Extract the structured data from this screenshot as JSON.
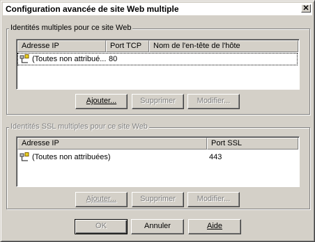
{
  "dialog": {
    "title": "Configuration avancée de site Web multiple",
    "close_glyph": "✕"
  },
  "identities": {
    "legend": "Identités multiples pour ce site Web",
    "columns": [
      "Adresse IP",
      "Port TCP",
      "Nom de l'en-tête de l'hôte"
    ],
    "rows": [
      {
        "ip": "(Toutes non attribué...",
        "port": "80",
        "host": ""
      }
    ],
    "buttons": {
      "add": "Ajouter...",
      "remove": "Supprimer",
      "modify": "Modifier..."
    }
  },
  "ssl": {
    "legend": "Identités SSL multiples pour ce site Web",
    "columns": [
      "Adresse IP",
      "Port SSL"
    ],
    "rows": [
      {
        "ip": "(Toutes non attribuées)",
        "port": "443"
      }
    ],
    "buttons": {
      "add": "Ajouter...",
      "remove": "Supprimer",
      "modify": "Modifier..."
    }
  },
  "footer": {
    "ok": "OK",
    "cancel": "Annuler",
    "help": "Aide"
  },
  "colors": {
    "face": "#d4d0c8",
    "disabled": "#808080"
  },
  "icons": {
    "network": "network-adapter-icon"
  }
}
